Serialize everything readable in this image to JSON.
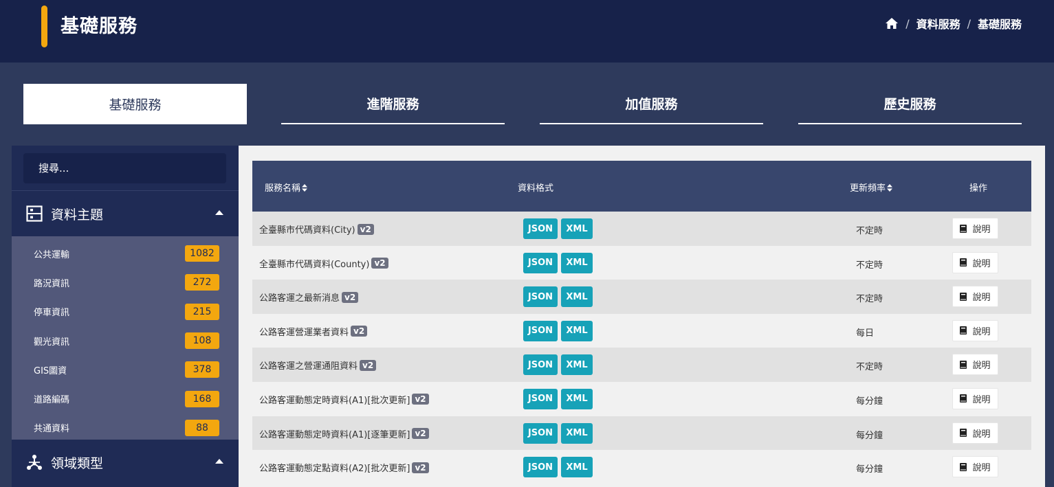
{
  "header": {
    "title": "基礎服務",
    "breadcrumb": [
      "資料服務",
      "基礎服務"
    ],
    "icons": {
      "home": "home-icon"
    }
  },
  "tabs": [
    {
      "label": "基礎服務",
      "active": true
    },
    {
      "label": "進階服務",
      "active": false
    },
    {
      "label": "加值服務",
      "active": false
    },
    {
      "label": "歷史服務",
      "active": false
    }
  ],
  "sidebar": {
    "search_placeholder": "搜尋...",
    "topic_section": {
      "label": "資料主題",
      "icon": "grid-box-icon"
    },
    "topics": [
      {
        "label": "公共運輸",
        "count": "1082"
      },
      {
        "label": "路況資訊",
        "count": "272"
      },
      {
        "label": "停車資訊",
        "count": "215"
      },
      {
        "label": "觀光資訊",
        "count": "108"
      },
      {
        "label": "GIS圖資",
        "count": "378"
      },
      {
        "label": "道路編碼",
        "count": "168"
      },
      {
        "label": "共通資料",
        "count": "88"
      }
    ],
    "domain_section": {
      "label": "領域類型",
      "icon": "network-icon"
    }
  },
  "table": {
    "headers": {
      "name": "服務名稱",
      "format": "資料格式",
      "frequency": "更新頻率",
      "action": "操作"
    },
    "format_labels": {
      "json": "JSON",
      "xml": "XML"
    },
    "doc_label": "說明",
    "version_badge": "v2",
    "rows": [
      {
        "name": "全臺縣市代碼資料(City)",
        "frequency": "不定時"
      },
      {
        "name": "全臺縣市代碼資料(County)",
        "frequency": "不定時"
      },
      {
        "name": "公路客運之最新消息",
        "frequency": "不定時"
      },
      {
        "name": "公路客運營運業者資料",
        "frequency": "每日"
      },
      {
        "name": "公路客運之營運通阻資料",
        "frequency": "不定時"
      },
      {
        "name": "公路客運動態定時資料(A1)[批次更新]",
        "frequency": "每分鐘"
      },
      {
        "name": "公路客運動態定時資料(A1)[逐筆更新]",
        "frequency": "每分鐘"
      },
      {
        "name": "公路客運動態定點資料(A2)[批次更新]",
        "frequency": "每分鐘"
      }
    ]
  },
  "colors": {
    "accent": "#f3a70f",
    "header_bg": "#17224a",
    "json_btn": "#17a2b8"
  }
}
